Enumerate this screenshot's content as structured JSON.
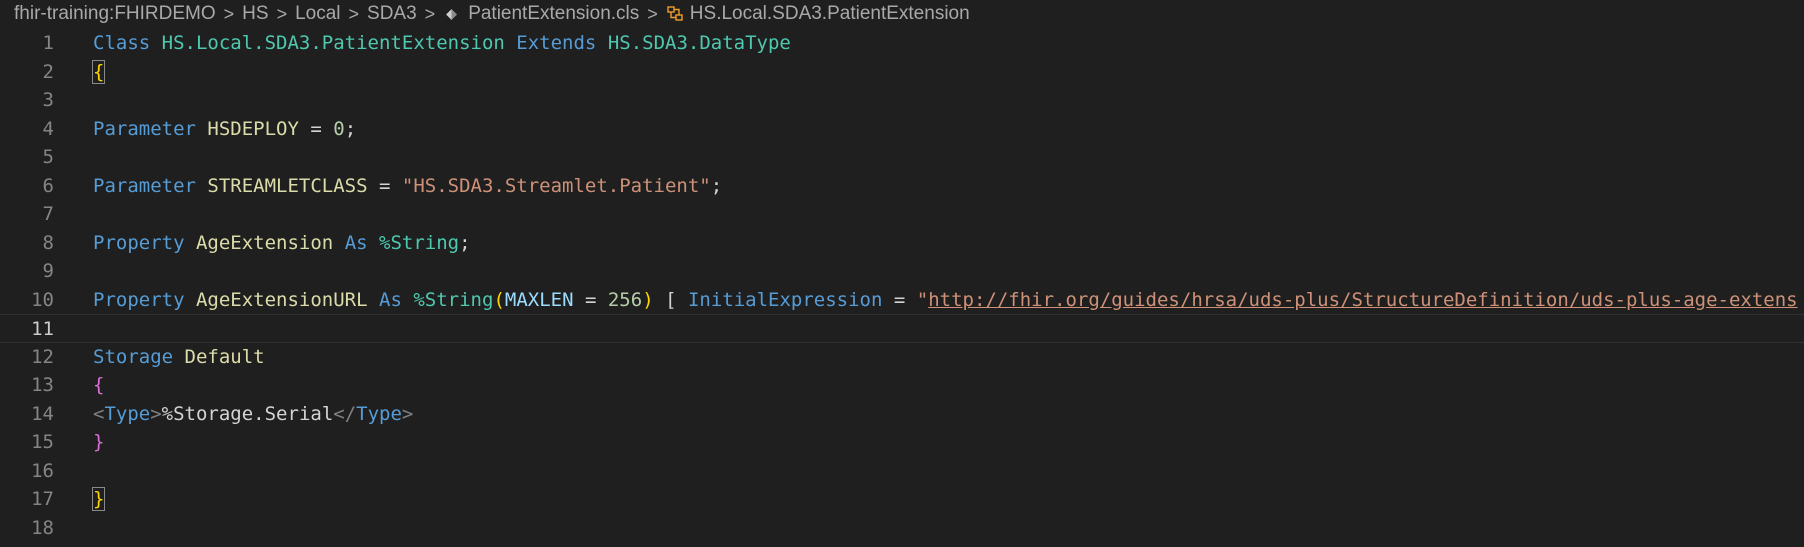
{
  "breadcrumb": {
    "items": [
      {
        "label": "fhir-training:FHIRDEMO"
      },
      {
        "label": "HS"
      },
      {
        "label": "Local"
      },
      {
        "label": "SDA3"
      },
      {
        "label": "PatientExtension.cls",
        "icon": "file-icon"
      },
      {
        "label": "HS.Local.SDA3.PatientExtension",
        "icon": "class-symbol-icon"
      }
    ],
    "separator": ">"
  },
  "editor": {
    "current_line": 11,
    "lines": [
      {
        "n": "1",
        "tokens": [
          [
            "kw",
            "Class"
          ],
          [
            "txt",
            " "
          ],
          [
            "cls",
            "HS.Local.SDA3.PatientExtension"
          ],
          [
            "txt",
            " "
          ],
          [
            "kw",
            "Extends"
          ],
          [
            "txt",
            " "
          ],
          [
            "cls",
            "HS.SDA3.DataType"
          ]
        ]
      },
      {
        "n": "2",
        "tokens": [
          [
            "brace-y bracket-box",
            "{"
          ]
        ]
      },
      {
        "n": "3",
        "tokens": []
      },
      {
        "n": "4",
        "tokens": [
          [
            "kw",
            "Parameter"
          ],
          [
            "txt",
            " "
          ],
          [
            "name",
            "HSDEPLOY"
          ],
          [
            "txt",
            " = "
          ],
          [
            "num",
            "0"
          ],
          [
            "txt",
            ";"
          ]
        ]
      },
      {
        "n": "5",
        "tokens": []
      },
      {
        "n": "6",
        "tokens": [
          [
            "kw",
            "Parameter"
          ],
          [
            "txt",
            " "
          ],
          [
            "name",
            "STREAMLETCLASS"
          ],
          [
            "txt",
            " = "
          ],
          [
            "str",
            "\"HS.SDA3.Streamlet.Patient\""
          ],
          [
            "txt",
            ";"
          ]
        ]
      },
      {
        "n": "7",
        "tokens": []
      },
      {
        "n": "8",
        "tokens": [
          [
            "kw",
            "Property"
          ],
          [
            "txt",
            " "
          ],
          [
            "name",
            "AgeExtension"
          ],
          [
            "txt",
            " "
          ],
          [
            "kw",
            "As"
          ],
          [
            "txt",
            " "
          ],
          [
            "cls",
            "%String"
          ],
          [
            "txt",
            ";"
          ]
        ]
      },
      {
        "n": "9",
        "tokens": []
      },
      {
        "n": "10",
        "tokens": [
          [
            "kw",
            "Property"
          ],
          [
            "txt",
            " "
          ],
          [
            "name",
            "AgeExtensionURL"
          ],
          [
            "txt",
            " "
          ],
          [
            "kw",
            "As"
          ],
          [
            "txt",
            " "
          ],
          [
            "cls",
            "%String"
          ],
          [
            "brace-y",
            "("
          ],
          [
            "param",
            "MAXLEN"
          ],
          [
            "txt",
            " = "
          ],
          [
            "num",
            "256"
          ],
          [
            "brace-y",
            ")"
          ],
          [
            "txt",
            " [ "
          ],
          [
            "kw",
            "InitialExpression"
          ],
          [
            "txt",
            " = "
          ],
          [
            "str",
            "\""
          ],
          [
            "url",
            "http://fhir.org/guides/hrsa/uds-plus/StructureDefinition/uds-plus-age-extens"
          ]
        ]
      },
      {
        "n": "11",
        "tokens": []
      },
      {
        "n": "12",
        "tokens": [
          [
            "kw",
            "Storage"
          ],
          [
            "txt",
            " "
          ],
          [
            "name",
            "Default"
          ]
        ]
      },
      {
        "n": "13",
        "tokens": [
          [
            "brace-p",
            "{"
          ]
        ]
      },
      {
        "n": "14",
        "tokens": [
          [
            "tag",
            "<"
          ],
          [
            "tagname",
            "Type"
          ],
          [
            "tag",
            ">"
          ],
          [
            "txt",
            "%Storage.Serial"
          ],
          [
            "tag",
            "</"
          ],
          [
            "tagname",
            "Type"
          ],
          [
            "tag",
            ">"
          ]
        ]
      },
      {
        "n": "15",
        "tokens": [
          [
            "brace-p",
            "}"
          ]
        ]
      },
      {
        "n": "16",
        "tokens": []
      },
      {
        "n": "17",
        "tokens": [
          [
            "brace-y bracket-box",
            "}"
          ]
        ]
      },
      {
        "n": "18",
        "tokens": []
      }
    ]
  }
}
